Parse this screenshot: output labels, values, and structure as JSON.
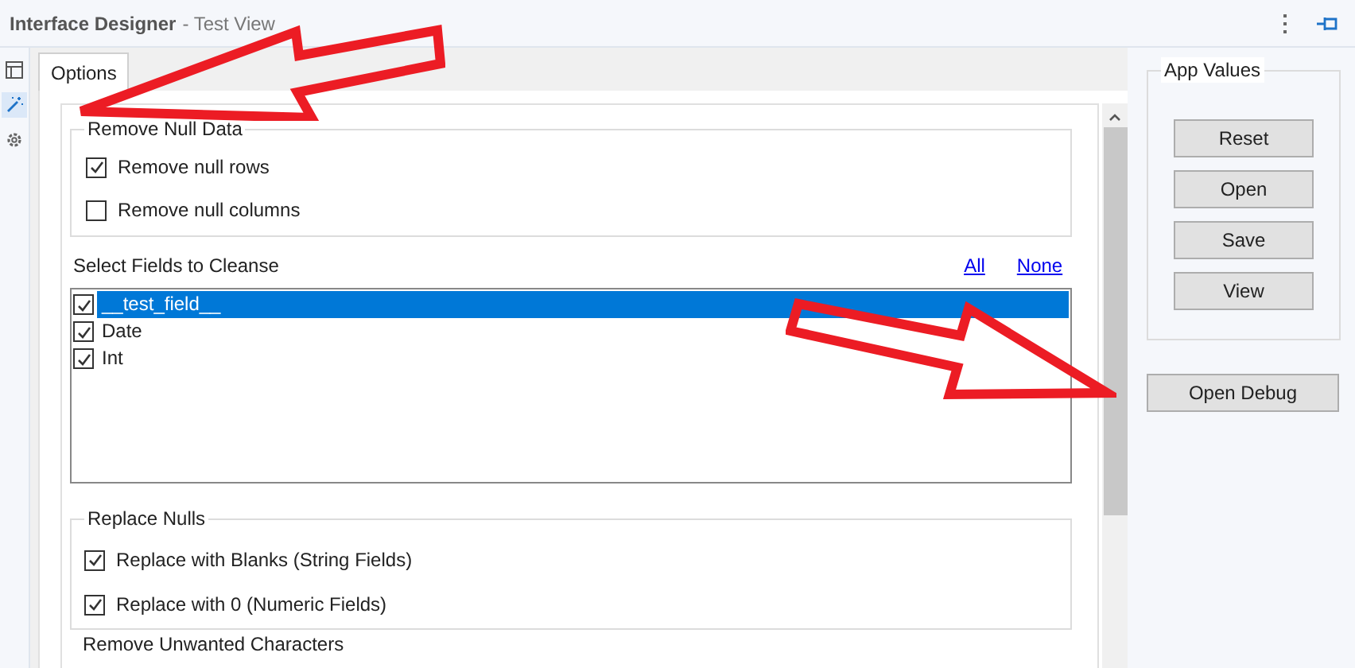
{
  "window": {
    "title": "Interface Designer",
    "subtitle": "- Test View"
  },
  "sidebar": {
    "items": [
      {
        "kind": "layout",
        "selected": false
      },
      {
        "kind": "wand",
        "selected": true
      },
      {
        "kind": "gear",
        "selected": false
      }
    ]
  },
  "tabs": [
    {
      "label": "Options",
      "selected": true
    }
  ],
  "remove_null_data": {
    "title": "Remove Null Data",
    "options": [
      {
        "label": "Remove null rows",
        "checked": true
      },
      {
        "label": "Remove null columns",
        "checked": false
      }
    ]
  },
  "fields": {
    "title": "Select Fields to Cleanse",
    "links": [
      "All",
      "None"
    ],
    "items": [
      {
        "label": "__test_field__",
        "checked": true,
        "selected": true
      },
      {
        "label": "Date",
        "checked": true,
        "selected": false
      },
      {
        "label": "Int",
        "checked": true,
        "selected": false
      }
    ]
  },
  "replace_nulls": {
    "title": "Replace Nulls",
    "options": [
      {
        "label": "Replace with Blanks (String Fields)",
        "checked": true
      },
      {
        "label": "Replace with 0 (Numeric Fields)",
        "checked": true
      }
    ]
  },
  "next_section": {
    "title": "Remove Unwanted Characters"
  },
  "app_values": {
    "title": "App Values",
    "buttons": [
      "Reset",
      "Open",
      "Save",
      "View"
    ]
  },
  "debug_button": "Open Debug"
}
